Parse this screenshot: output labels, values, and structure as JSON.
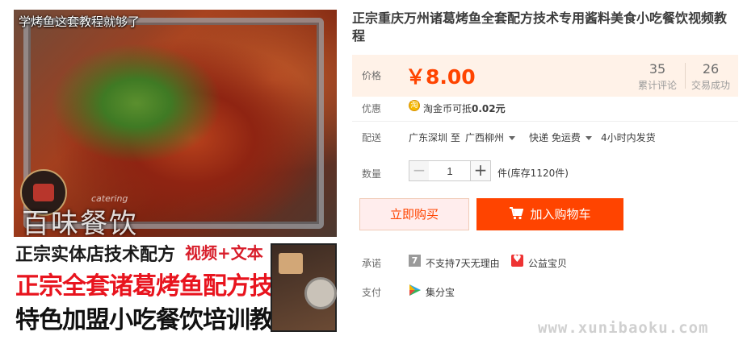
{
  "image": {
    "caption_top": "学烤鱼这套教程就够了",
    "brand_text": "百味餐饮",
    "brand_sub": "catering",
    "banner_line1": "正宗实体店技术配方",
    "banner_tag": "视频+文本",
    "banner_line2": "正宗全套诸葛烤鱼配方技术方",
    "banner_line3": "特色加盟小吃餐饮培训教程"
  },
  "product": {
    "title": "正宗重庆万州诸葛烤鱼全套配方技术专用酱料美食小吃餐饮视频教程"
  },
  "price": {
    "label": "价格",
    "value": "￥8.00",
    "reviews_count": "35",
    "reviews_label": "累计评论",
    "sales_count": "26",
    "sales_label": "交易成功"
  },
  "discount": {
    "label": "优惠",
    "icon_char": "淘",
    "text_prefix": "淘金币可抵",
    "text_amount": "0.02元"
  },
  "shipping": {
    "label": "配送",
    "from": "广东深圳 至",
    "to": "广西柳州",
    "method": "快递 免运费",
    "time": "4小时内发货"
  },
  "quantity": {
    "label": "数量",
    "minus": "−",
    "value": "1",
    "plus": "+",
    "stock": "件(库存1120件)"
  },
  "actions": {
    "buy_now": "立即购买",
    "add_cart": "加入购物车"
  },
  "promise": {
    "label": "承诺",
    "icon1_char": "7",
    "item1": "不支持7天无理由",
    "item2": "公益宝贝"
  },
  "payment": {
    "label": "支付",
    "method": "集分宝"
  },
  "watermark": "www.xunibaoku.com",
  "colors": {
    "accent": "#ff4400",
    "price_bg": "#fff2e8",
    "buy_now_bg": "#ffeded"
  }
}
